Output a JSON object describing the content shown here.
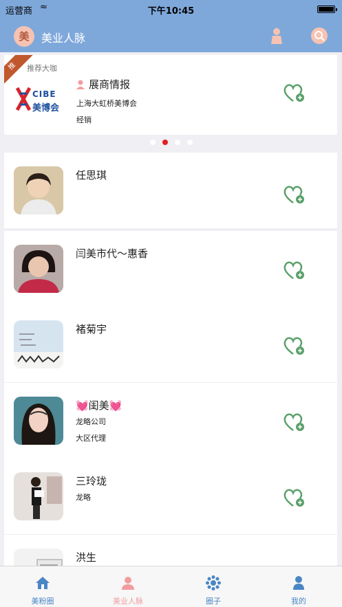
{
  "status": {
    "carrier": "运营商",
    "time": "下午10:45"
  },
  "navbar": {
    "logo_char": "美",
    "title": "美业人脉"
  },
  "banner": {
    "ribbon": "推",
    "tag": "推荐大咖",
    "logo_text": "CIBE",
    "logo_cn": "美博会",
    "name": "展商情报",
    "line2": "上海大虹桥美博会",
    "line3": "经销"
  },
  "contacts": [
    {
      "name": "任思琪",
      "sub1": "",
      "sub2": ""
    },
    {
      "name": "闫美市代～惠香",
      "sub1": "",
      "sub2": ""
    },
    {
      "name": "褚菊宇",
      "sub1": "",
      "sub2": ""
    },
    {
      "name": "💓闺美💓",
      "sub1": "龙略公司",
      "sub2": "大区代理"
    },
    {
      "name": "三玲珑",
      "sub1": "龙略",
      "sub2": ""
    },
    {
      "name": "洪生",
      "sub1": "",
      "sub2": ""
    }
  ],
  "tabs": [
    {
      "label": "美粉圈"
    },
    {
      "label": "美业人脉"
    },
    {
      "label": "圈子"
    },
    {
      "label": "我的"
    }
  ],
  "colors": {
    "nav": "#7fa8da",
    "follow": "#5aa06a",
    "tab_active": "#f29c9f",
    "tab": "#4a86c5"
  }
}
